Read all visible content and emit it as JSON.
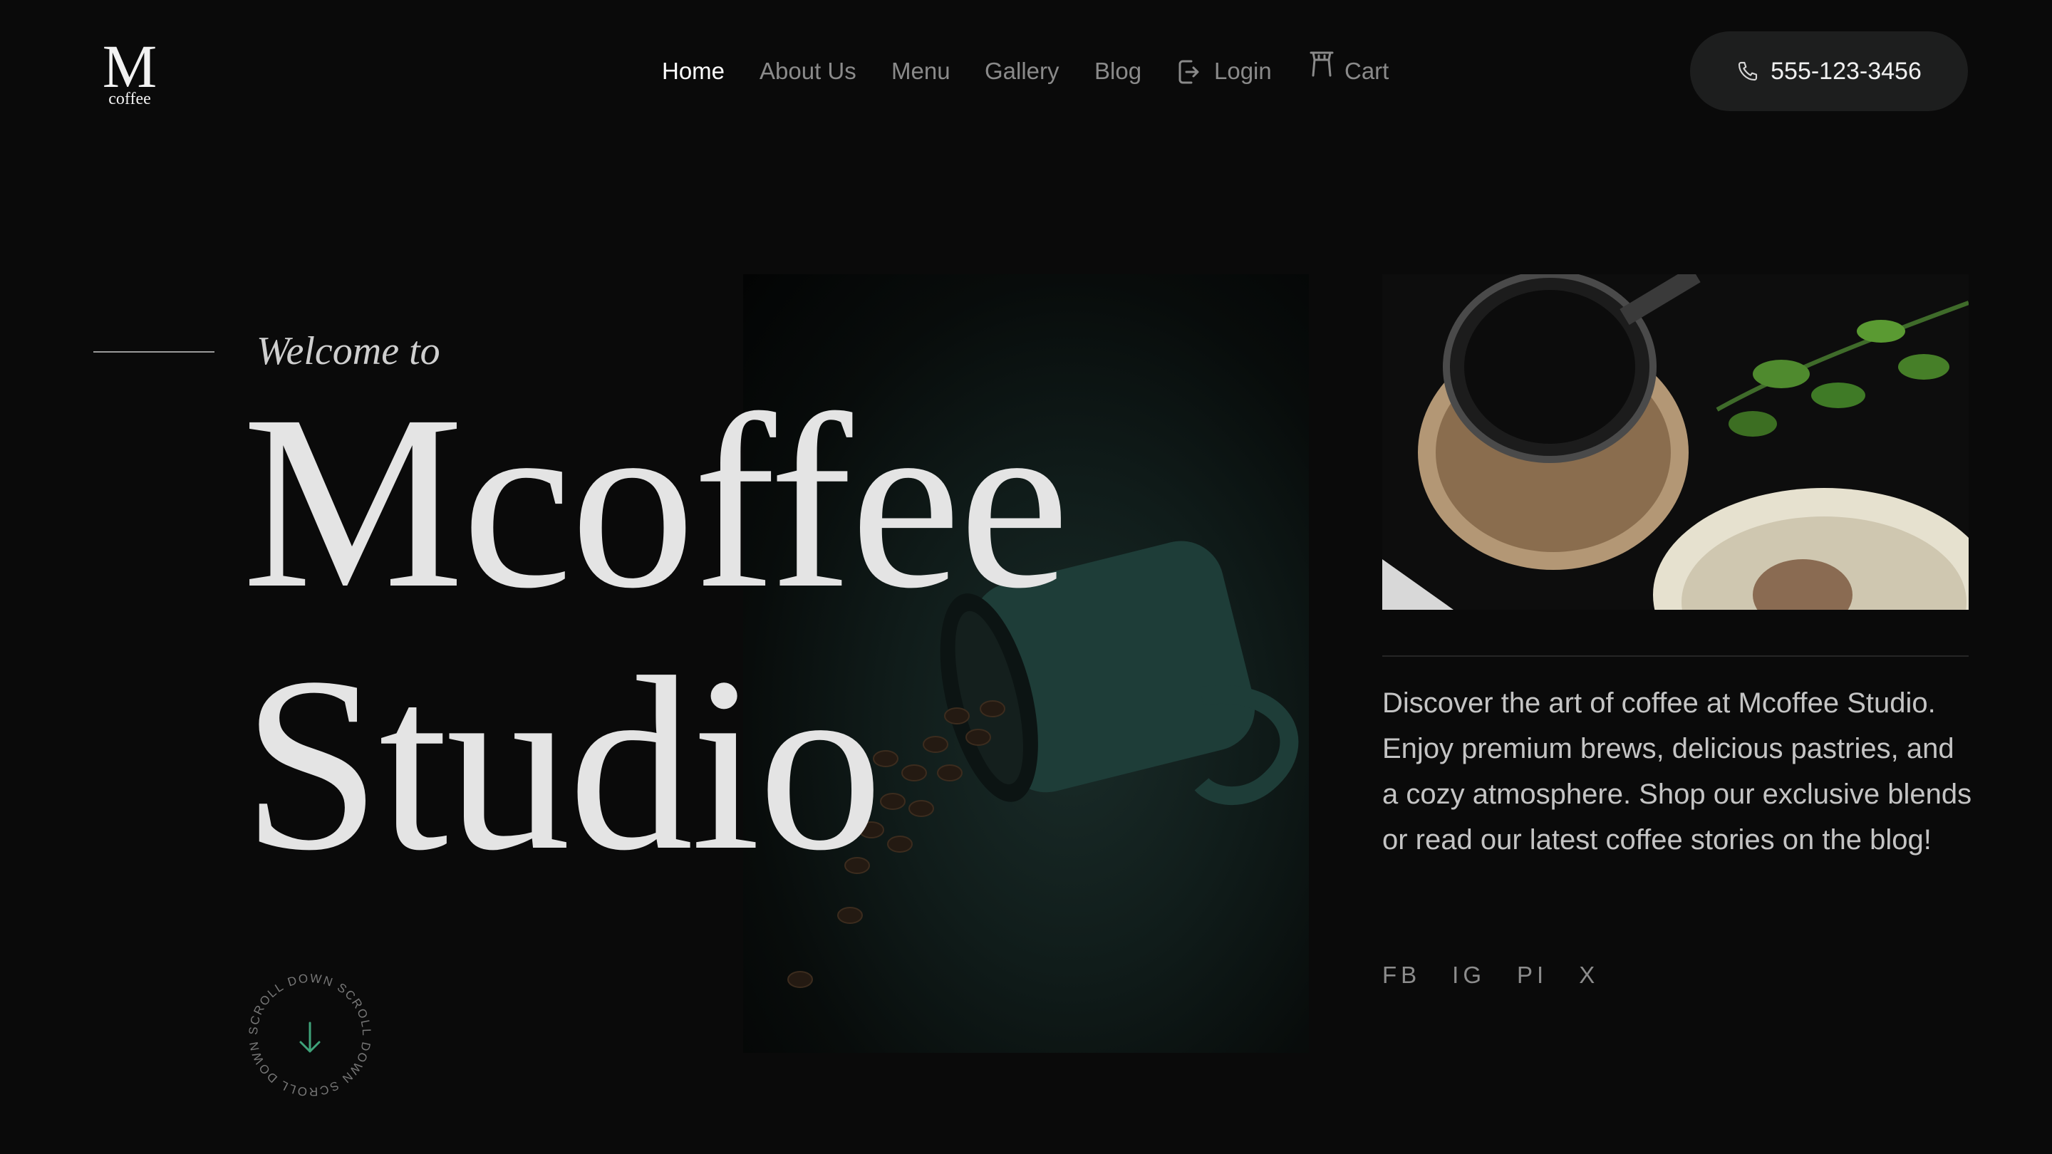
{
  "logo": {
    "mark": "M",
    "wordmark": "coffee"
  },
  "nav": {
    "items": [
      {
        "label": "Home",
        "active": true
      },
      {
        "label": "About Us"
      },
      {
        "label": "Menu"
      },
      {
        "label": "Gallery"
      },
      {
        "label": "Blog"
      },
      {
        "label": "Login",
        "icon": "login-icon"
      },
      {
        "label": "Cart",
        "icon": "cart-icon"
      }
    ]
  },
  "phone": {
    "label": "555-123-3456",
    "icon": "phone-icon"
  },
  "hero": {
    "welcome": "Welcome to",
    "title_line1": "Mcoffee",
    "title_line2": "Studio"
  },
  "description": "Discover the art of coffee at Mcoffee Studio. Enjoy premium brews, delicious pastries, and a cozy atmosphere. Shop our exclusive blends or read our latest coffee stories on the blog!",
  "socials": [
    "FB",
    "IG",
    "PI",
    "X"
  ],
  "scroll": {
    "text": "SCROLL DOWN SCROLL DOWN SCROLL DOWN",
    "icon": "arrow-down-icon"
  },
  "colors": {
    "background": "#0a0a0a",
    "accent": "#3fa37a",
    "pill": "#1d1e1e"
  }
}
